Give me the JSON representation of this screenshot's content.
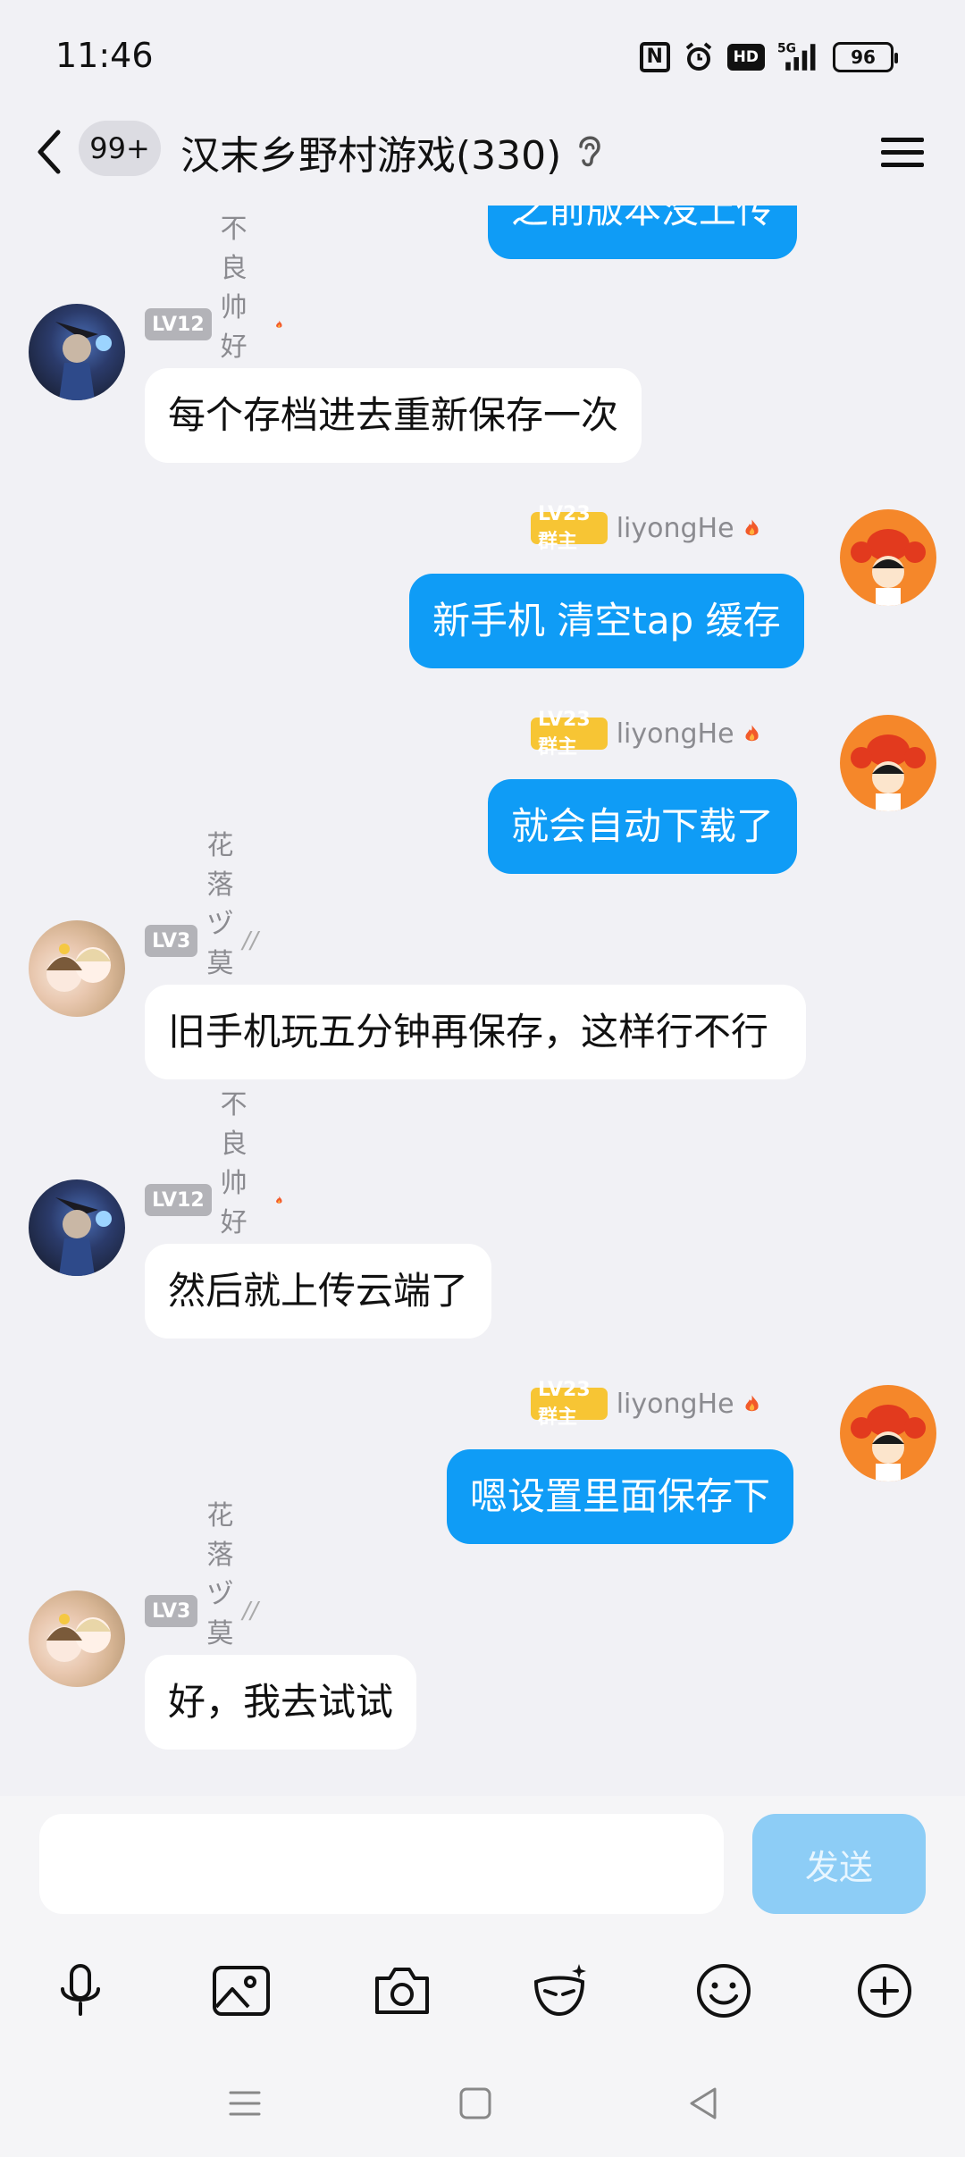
{
  "status_bar": {
    "time": "11:46",
    "hd": "HD",
    "network": "5G",
    "battery": "96"
  },
  "header": {
    "unread_count": "99+",
    "title": "汉末乡野村游戏(330)"
  },
  "partial_top_message": "之前版本没上传",
  "messages": [
    {
      "side": "left",
      "level": "LV12",
      "nick": "不良帅好不帅",
      "text": "每个存档进去重新保存一次",
      "avatar": "knight-avatar"
    },
    {
      "side": "right",
      "level": "LV23 群主",
      "nick": "liyongHe",
      "text": "新手机 清空tap 缓存",
      "avatar": "lobster-avatar"
    },
    {
      "side": "right",
      "level": "LV23 群主",
      "nick": "liyongHe",
      "text": "就会自动下载了",
      "avatar": "lobster-avatar"
    },
    {
      "side": "left",
      "level": "LV3",
      "nick": "花落ヅ莫相离",
      "text": "旧手机玩五分钟再保存，这样行不行",
      "avatar": "girls-avatar"
    },
    {
      "side": "left",
      "level": "LV12",
      "nick": "不良帅好不帅",
      "text": "然后就上传云端了",
      "avatar": "knight-avatar"
    },
    {
      "side": "right",
      "level": "LV23 群主",
      "nick": "liyongHe",
      "text": "嗯设置里面保存下",
      "avatar": "lobster-avatar"
    },
    {
      "side": "left",
      "level": "LV3",
      "nick": "花落ヅ莫相离",
      "text": "好，我去试试",
      "avatar": "girls-avatar"
    }
  ],
  "input": {
    "value": "",
    "send_label": "发送"
  },
  "colors": {
    "bubble_self": "#0f9cf6",
    "bubble_other": "#ffffff",
    "owner_badge": "#f7c534",
    "level_badge": "#b3b3b8"
  }
}
